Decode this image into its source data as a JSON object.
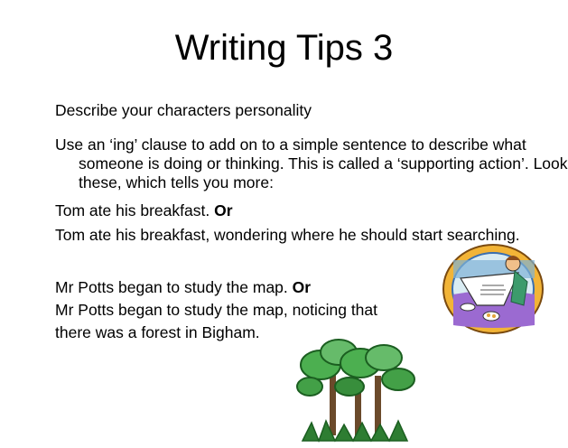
{
  "slide": {
    "title": "Writing Tips 3",
    "subheading": "Describe your characters personality",
    "instruction": "Use an ‘ing’ clause to add on to a simple sentence to describe what someone is doing or thinking. This is called a ‘supporting action’. Look at these, which tells you more:",
    "example1": {
      "simple": "Tom ate his breakfast.",
      "or_label": "Or",
      "extended": "Tom ate his breakfast, wondering where he should start searching."
    },
    "example2": {
      "simple": "Mr Potts began to study the map.",
      "or_label": "Or",
      "extended_line1": "Mr Potts began to study the map, noticing that",
      "extended_line2": "there was a forest in Bigham."
    },
    "images": {
      "reader": "newspaper-reader-clipart",
      "trees": "forest-trees-clipart"
    }
  }
}
